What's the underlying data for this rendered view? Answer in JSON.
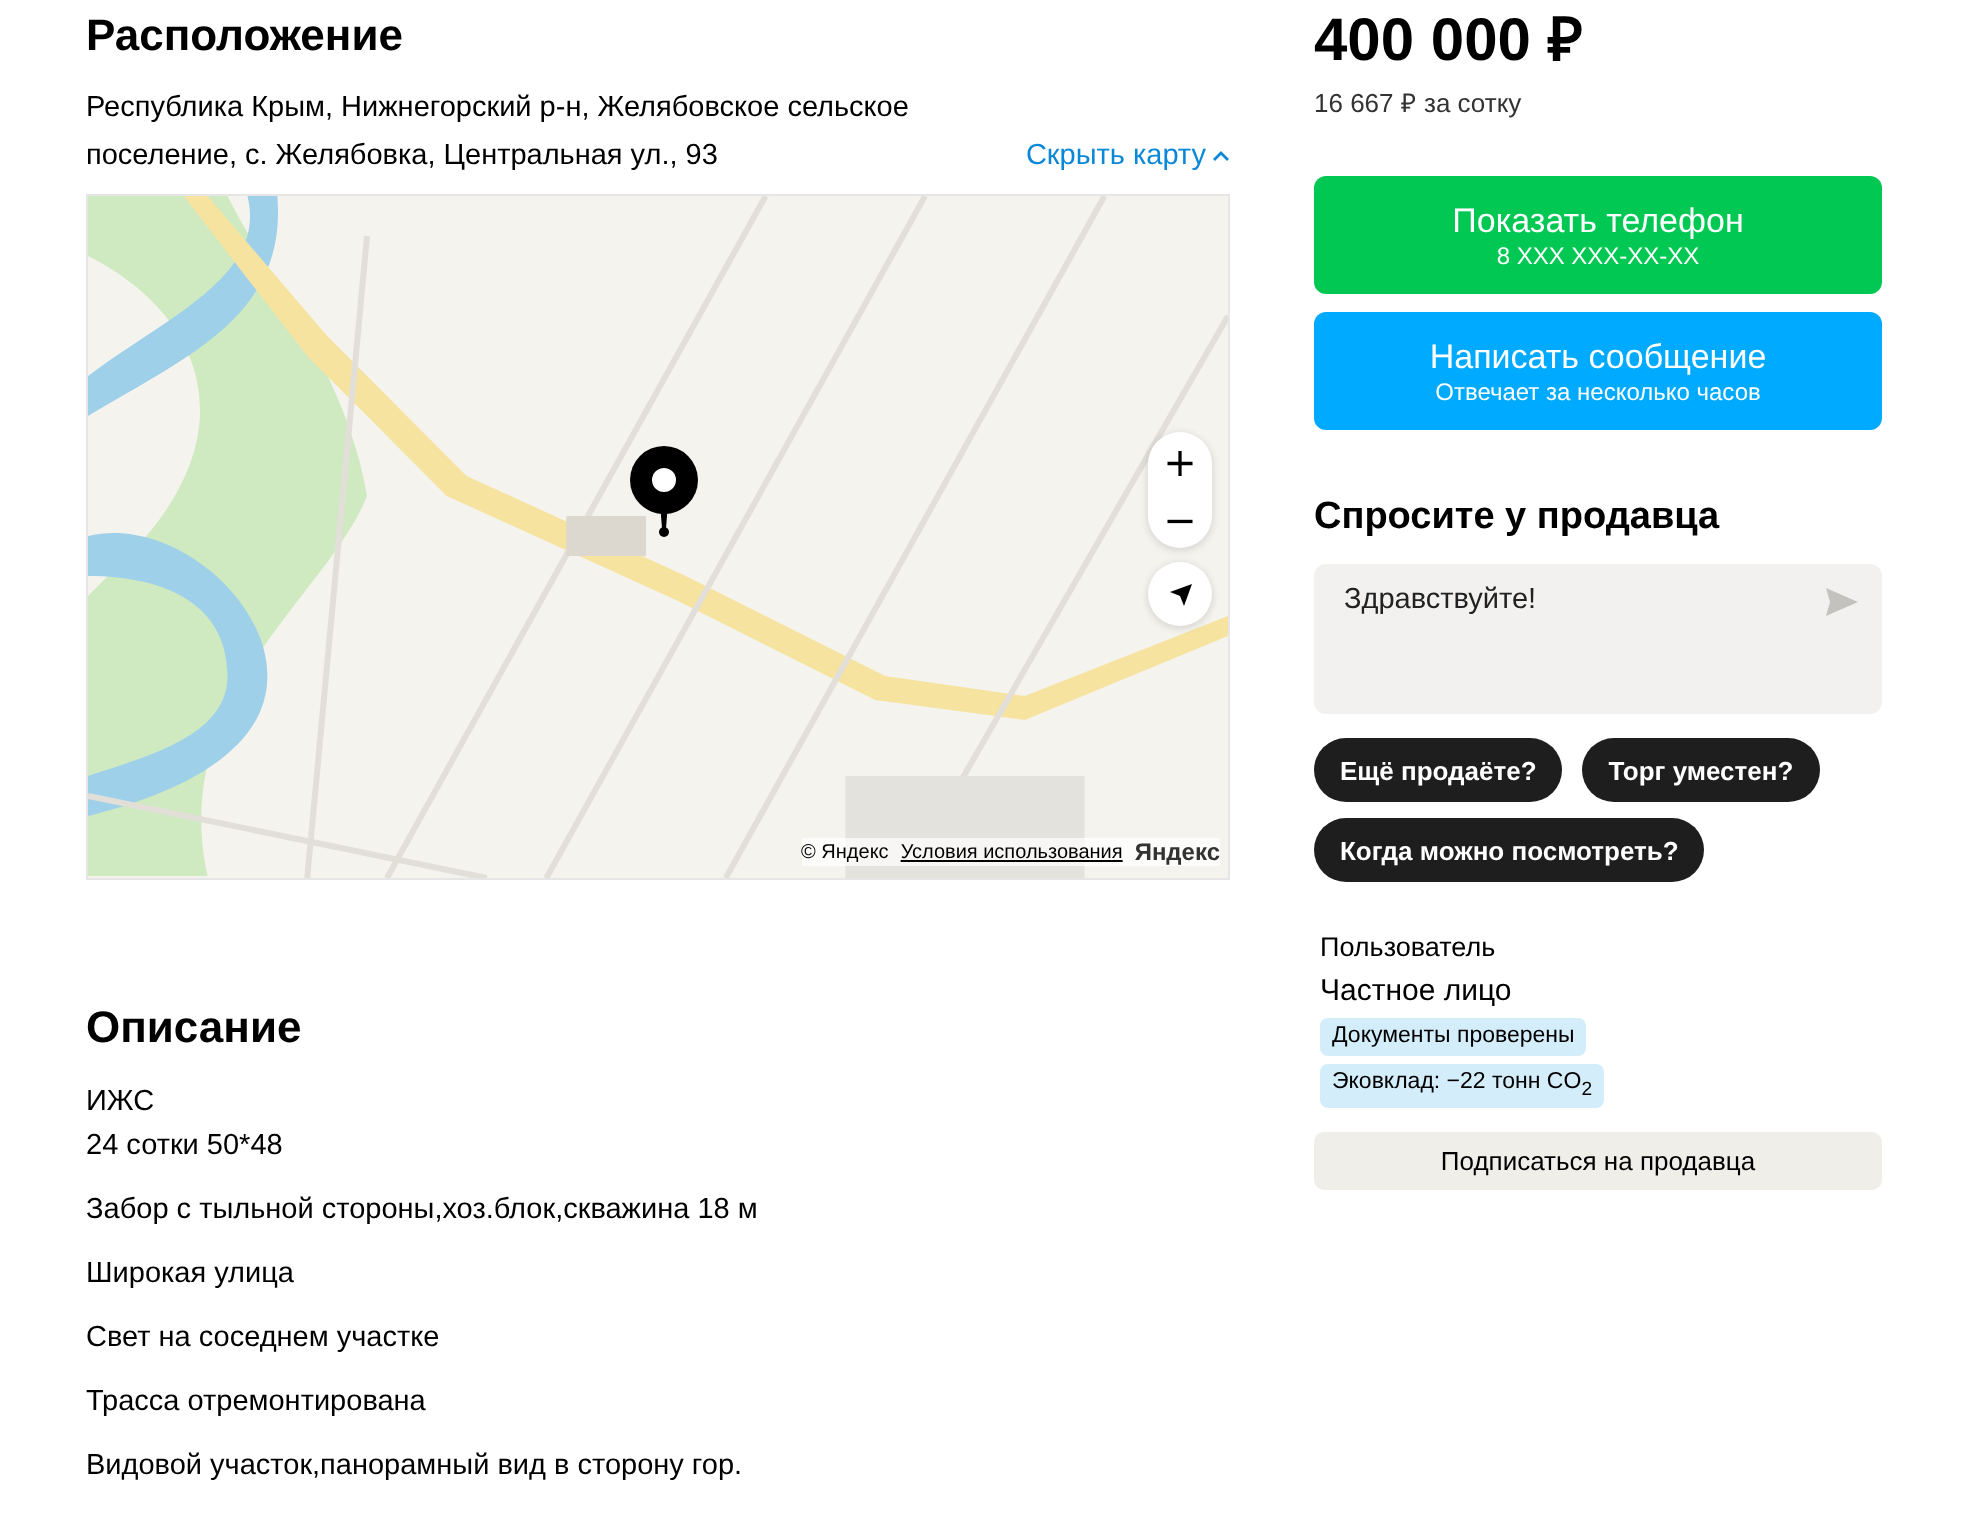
{
  "location": {
    "title": "Расположение",
    "address": "Республика Крым, Нижнегорский р-н, Желябовское сельское поселение, с. Желябовка, Центральная ул., 93",
    "toggle_link": "Скрыть карту",
    "map": {
      "kind": "picture",
      "attribution": "© Яндекс",
      "terms_link": "Условия использования",
      "logo": "Яндекс",
      "zoom_in": "+",
      "zoom_out": "−"
    }
  },
  "description": {
    "title": "Описание",
    "paragraphs": [
      [
        "ИЖС",
        "24 сотки 50*48"
      ],
      [
        "Забор с тыльной стороны,хоз.блок,скважина 18 м"
      ],
      [
        "Широкая улица"
      ],
      [
        "Свет на соседнем участке"
      ],
      [
        "Трасса отремонтирована"
      ],
      [
        "Видовой участок,панорамный вид в сторону гор."
      ]
    ]
  },
  "price": {
    "value": "400 000 ₽",
    "per_unit": "16 667 ₽ за сотку"
  },
  "actions": [
    {
      "kind": "phone",
      "label": "Показать телефон",
      "sub": "8 XXX XXX-XX-XX"
    },
    {
      "kind": "message",
      "label": "Написать сообщение",
      "sub": "Отвечает за несколько часов"
    }
  ],
  "ask": {
    "title": "Спросите у продавца",
    "message": "Здравствуйте!",
    "suggestions": [
      "Ещё продаёте?",
      "Торг уместен?",
      "Когда можно посмотреть?"
    ]
  },
  "seller": {
    "role": "Пользователь",
    "type": "Частное лицо",
    "badges": [
      "Документы проверены",
      "Эковклад: −22 тонн CO$_{2}$"
    ],
    "subscribe": "Подписаться на продавца"
  }
}
